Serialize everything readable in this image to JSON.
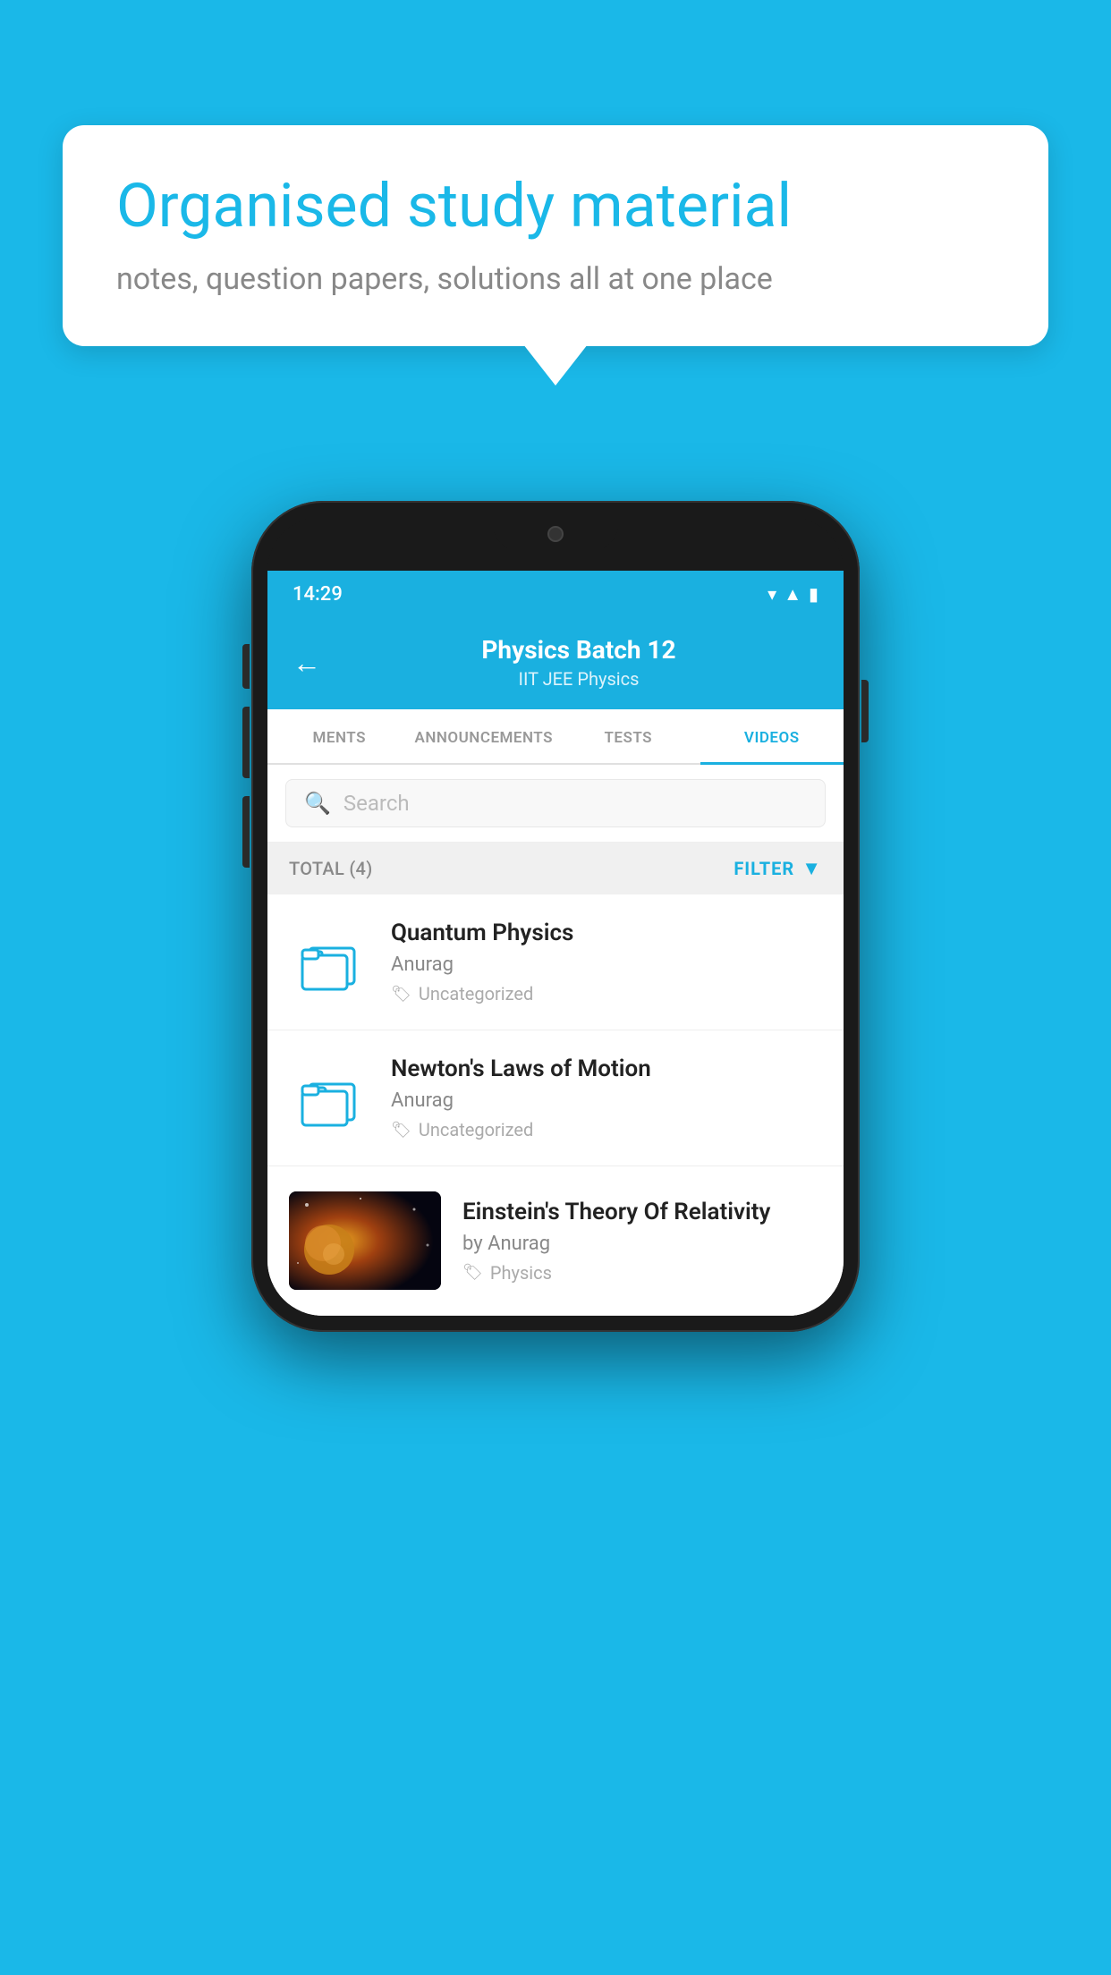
{
  "background_color": "#1ab8e8",
  "speech_bubble": {
    "title": "Organised study material",
    "subtitle": "notes, question papers, solutions all at one place"
  },
  "phone": {
    "status_bar": {
      "time": "14:29",
      "icons": [
        "wifi",
        "signal",
        "battery"
      ]
    },
    "header": {
      "back_label": "←",
      "title": "Physics Batch 12",
      "subtitle": "IIT JEE   Physics"
    },
    "tabs": [
      {
        "label": "MENTS",
        "active": false
      },
      {
        "label": "ANNOUNCEMENTS",
        "active": false
      },
      {
        "label": "TESTS",
        "active": false
      },
      {
        "label": "VIDEOS",
        "active": true
      }
    ],
    "search": {
      "placeholder": "Search"
    },
    "filter_row": {
      "total_label": "TOTAL (4)",
      "filter_label": "FILTER"
    },
    "videos": [
      {
        "title": "Quantum Physics",
        "author": "Anurag",
        "tag": "Uncategorized",
        "has_thumbnail": false
      },
      {
        "title": "Newton's Laws of Motion",
        "author": "Anurag",
        "tag": "Uncategorized",
        "has_thumbnail": false
      },
      {
        "title": "Einstein's Theory Of Relativity",
        "author": "by Anurag",
        "tag": "Physics",
        "has_thumbnail": true
      }
    ]
  }
}
